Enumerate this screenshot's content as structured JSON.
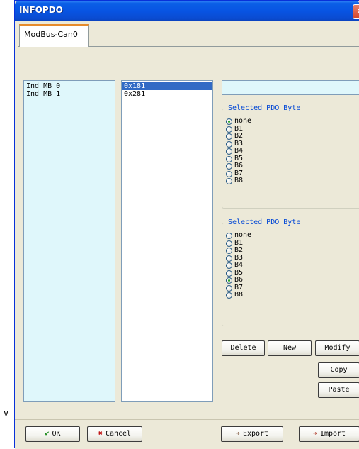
{
  "window": {
    "title": "INFOPDO",
    "close_glyph": "✕"
  },
  "tabs": [
    {
      "label": "ModBus-Can0",
      "selected": true
    }
  ],
  "left_list": {
    "items": [
      "Ind MB 0",
      "Ind MB 1"
    ]
  },
  "mid_list": {
    "items": [
      {
        "label": "0x181",
        "selected": true
      },
      {
        "label": "0x281",
        "selected": false
      }
    ]
  },
  "textfield": {
    "value": ""
  },
  "group1": {
    "legend": "Selected PDO Byte",
    "options": [
      "none",
      "B1",
      "B2",
      "B3",
      "B4",
      "B5",
      "B6",
      "B7",
      "B8"
    ],
    "selected": "none"
  },
  "group2": {
    "legend": "Selected PDO Byte",
    "options": [
      "none",
      "B1",
      "B2",
      "B3",
      "B4",
      "B5",
      "B6",
      "B7",
      "B8"
    ],
    "selected": "B6"
  },
  "buttons": {
    "delete": "Delete",
    "new": "New",
    "modify": "Modify",
    "copy": "Copy",
    "paste": "Paste",
    "ok": "OK",
    "cancel": "Cancel",
    "export": "Export",
    "import": "Import"
  },
  "stray_text": "v",
  "icons": {
    "ok": "check-icon",
    "cancel": "x-icon",
    "export": "export-icon",
    "import": "import-icon"
  }
}
